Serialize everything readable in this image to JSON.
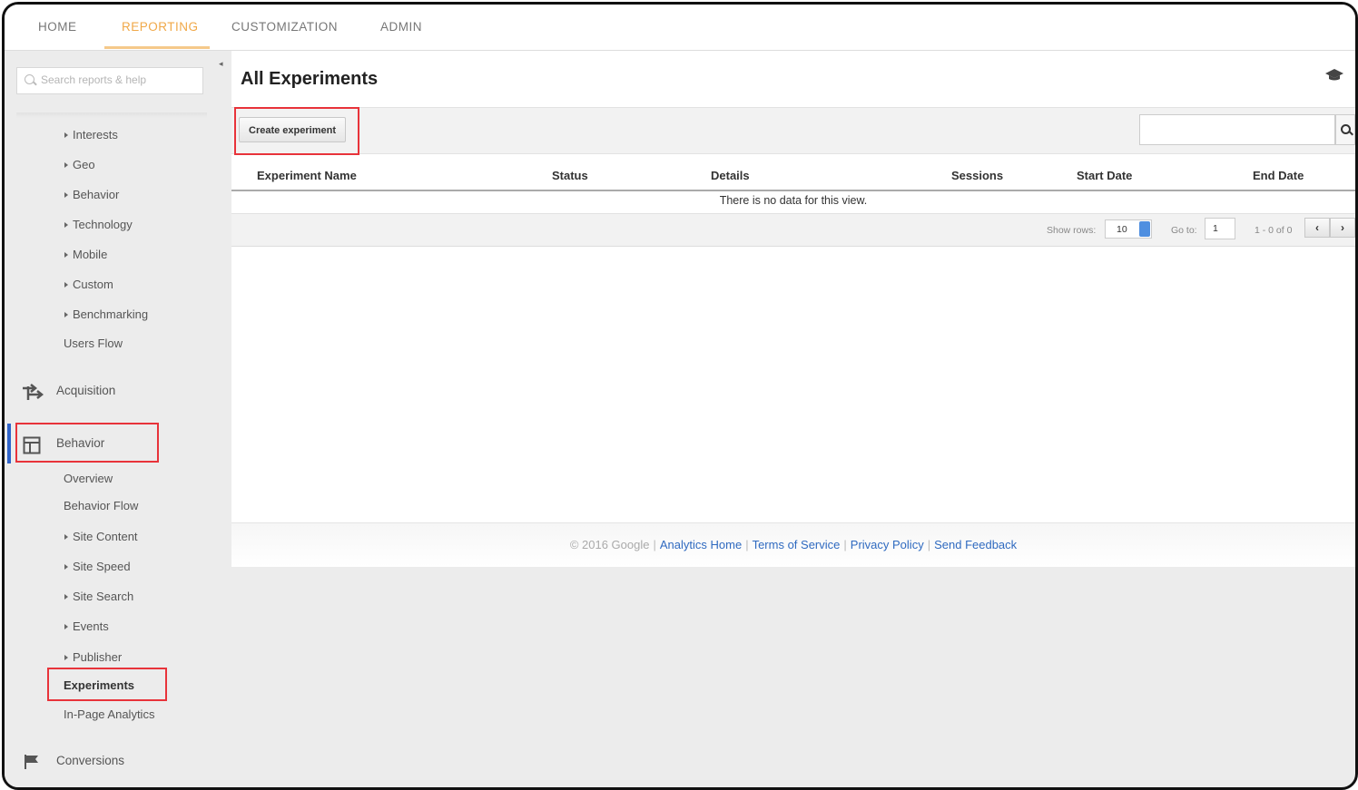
{
  "topnav": {
    "tabs": [
      {
        "label": "HOME"
      },
      {
        "label": "REPORTING"
      },
      {
        "label": "CUSTOMIZATION"
      },
      {
        "label": "ADMIN"
      }
    ]
  },
  "sidebar": {
    "search_placeholder": "Search reports & help",
    "audience_items": [
      {
        "label": "Interests"
      },
      {
        "label": "Geo"
      },
      {
        "label": "Behavior"
      },
      {
        "label": "Technology"
      },
      {
        "label": "Mobile"
      },
      {
        "label": "Custom"
      },
      {
        "label": "Benchmarking"
      },
      {
        "label": "Users Flow"
      }
    ],
    "acquisition_label": "Acquisition",
    "behavior_label": "Behavior",
    "behavior_items": [
      {
        "label": "Overview"
      },
      {
        "label": "Behavior Flow"
      },
      {
        "label": "Site Content"
      },
      {
        "label": "Site Speed"
      },
      {
        "label": "Site Search"
      },
      {
        "label": "Events"
      },
      {
        "label": "Publisher"
      },
      {
        "label": "Experiments"
      },
      {
        "label": "In-Page Analytics"
      }
    ],
    "conversions_label": "Conversions"
  },
  "main": {
    "title": "All Experiments",
    "create_button": "Create experiment",
    "columns": [
      "Experiment Name",
      "Status",
      "Details",
      "Sessions",
      "Start Date",
      "End Date"
    ],
    "empty_message": "There is no data for this view.",
    "pager": {
      "show_rows_label": "Show rows:",
      "show_rows_value": "10",
      "goto_label": "Go to:",
      "goto_value": "1",
      "range_text": "1 - 0 of 0",
      "prev": "‹",
      "next": "›"
    }
  },
  "footer": {
    "copyright": "© 2016 Google",
    "links": [
      "Analytics Home",
      "Terms of Service",
      "Privacy Policy",
      "Send Feedback"
    ]
  },
  "colors": {
    "active_tab": "#f0a848",
    "highlight_box": "#e8333a",
    "link": "#2f6ac0",
    "active_section_bar": "#2f63c9"
  }
}
